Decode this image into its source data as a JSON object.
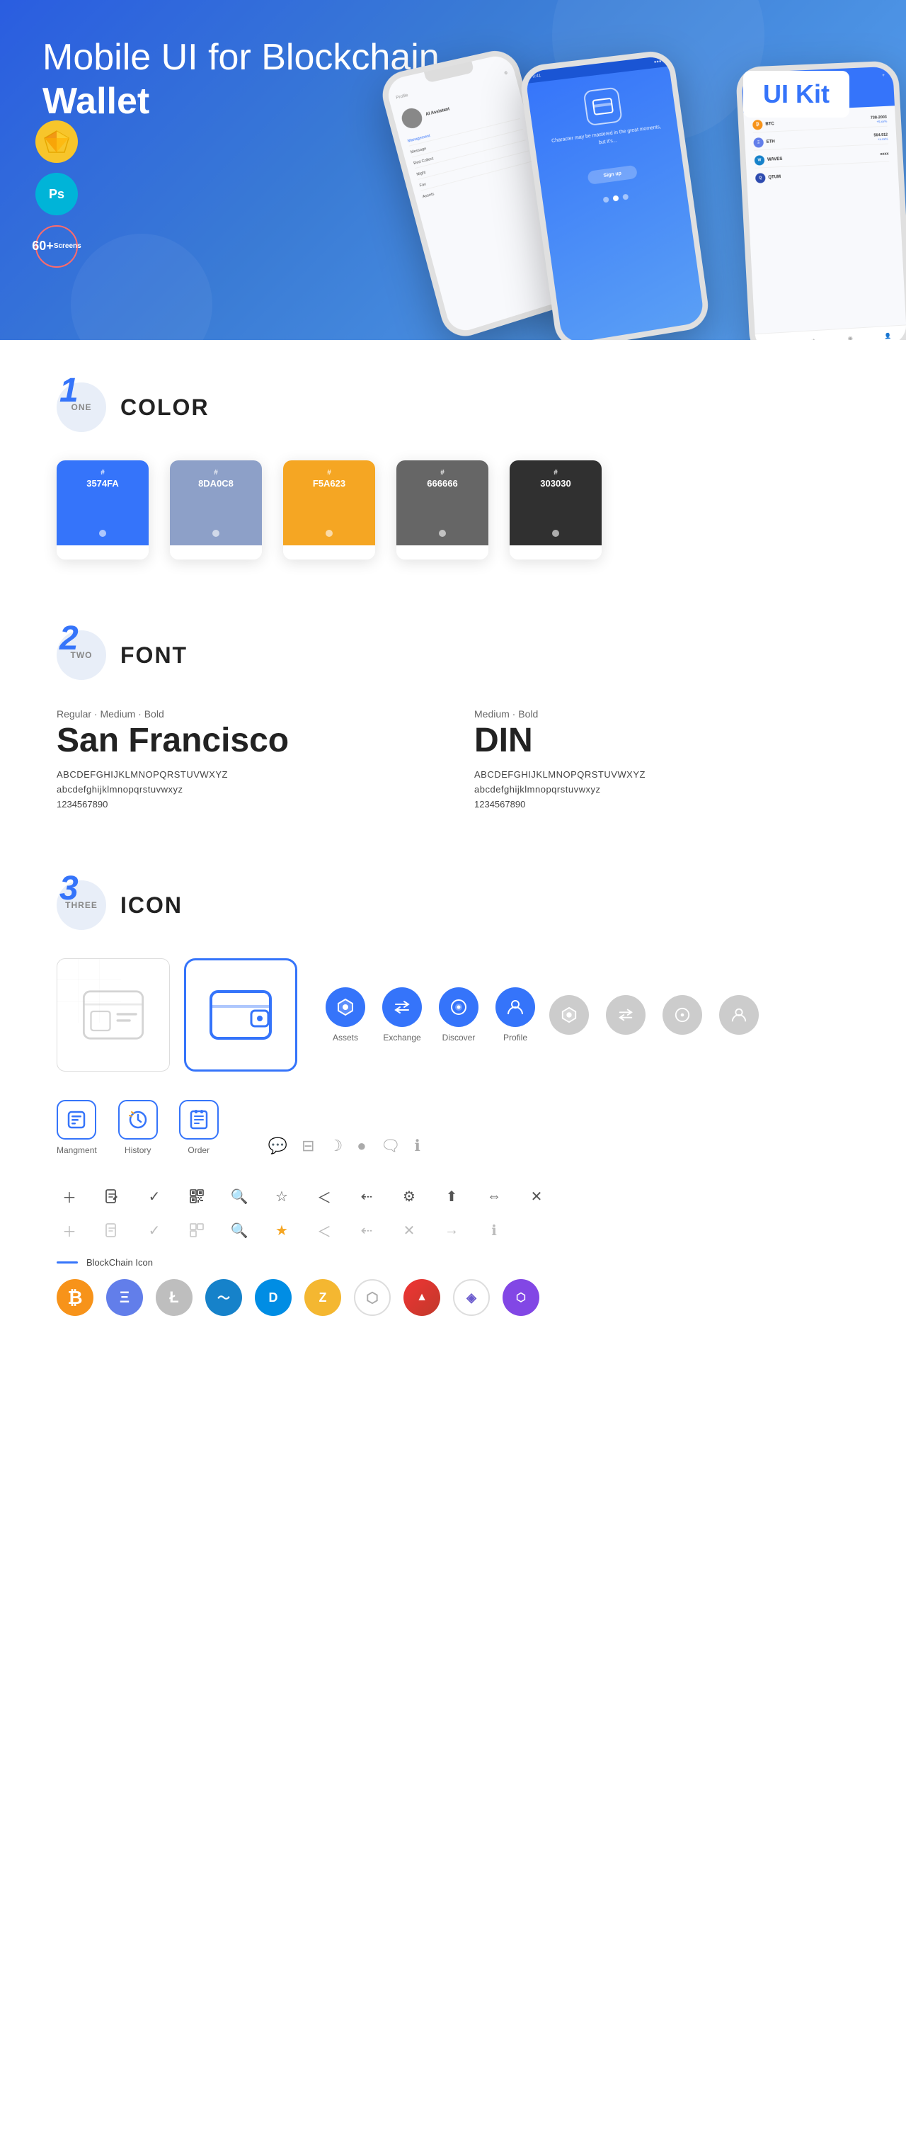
{
  "hero": {
    "title_normal": "Mobile UI for Blockchain ",
    "title_bold": "Wallet",
    "badge": "UI Kit",
    "sketch_label": "Sketch",
    "ps_label": "Ps",
    "screens_label": "60+\nScreens"
  },
  "sections": {
    "color": {
      "number": "1",
      "number_label": "ONE",
      "title": "COLOR",
      "swatches": [
        {
          "hex": "#3574FA",
          "label": "#",
          "value": "3574FA",
          "bg": "#3574FA"
        },
        {
          "hex": "#8DA0C8",
          "label": "#",
          "value": "8DA0C8",
          "bg": "#8DA0C8"
        },
        {
          "hex": "#F5A623",
          "label": "#",
          "value": "F5A623",
          "bg": "#F5A623"
        },
        {
          "hex": "#666666",
          "label": "#",
          "value": "666666",
          "bg": "#666666"
        },
        {
          "hex": "#303030",
          "label": "#",
          "value": "303030",
          "bg": "#303030"
        }
      ]
    },
    "font": {
      "number": "2",
      "number_label": "TWO",
      "title": "FONT",
      "fonts": [
        {
          "style_label": "Regular · Medium · Bold",
          "name": "San Francisco",
          "uppercase": "ABCDEFGHIJKLMNOPQRSTUVWXYZ",
          "lowercase": "abcdefghijklmnopqrstuvwxyz",
          "numbers": "1234567890"
        },
        {
          "style_label": "Medium · Bold",
          "name": "DIN",
          "uppercase": "ABCDEFGHIJKLMNOPQRSTUVWXYZ",
          "lowercase": "abcdefghijklmnopqrstuvwxyz",
          "numbers": "1234567890"
        }
      ]
    },
    "icon": {
      "number": "3",
      "number_label": "THREE",
      "title": "ICON",
      "nav_icons": [
        {
          "label": "Assets"
        },
        {
          "label": "Exchange"
        },
        {
          "label": "Discover"
        },
        {
          "label": "Profile"
        }
      ],
      "app_icons": [
        {
          "label": "Mangment"
        },
        {
          "label": "History"
        },
        {
          "label": "Order"
        }
      ],
      "blockchain_label": "BlockChain Icon",
      "crypto_names": [
        "BTC",
        "ETH",
        "LTC",
        "WAVES",
        "DASH",
        "ZEC",
        "GRID",
        "ARK",
        "GEM",
        "MATIC"
      ]
    }
  }
}
